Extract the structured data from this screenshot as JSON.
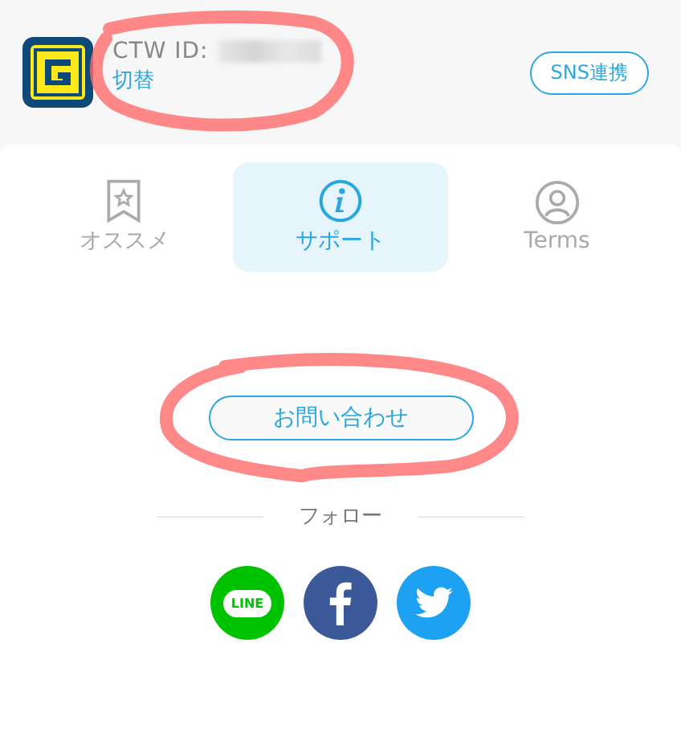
{
  "account": {
    "id_label": "CTW ID:",
    "switch_link": "切替",
    "sns_button": "SNS連携"
  },
  "tabs": [
    {
      "label": "オススメ",
      "kind": "bookmark",
      "selected": false
    },
    {
      "label": "サポート",
      "kind": "info",
      "selected": true
    },
    {
      "label": "Terms",
      "kind": "person",
      "selected": false
    }
  ],
  "contact_button": "お問い合わせ",
  "follow": {
    "heading": "フォロー",
    "links": [
      {
        "kind": "line",
        "label": "LINE"
      },
      {
        "kind": "facebook"
      },
      {
        "kind": "twitter"
      }
    ]
  }
}
